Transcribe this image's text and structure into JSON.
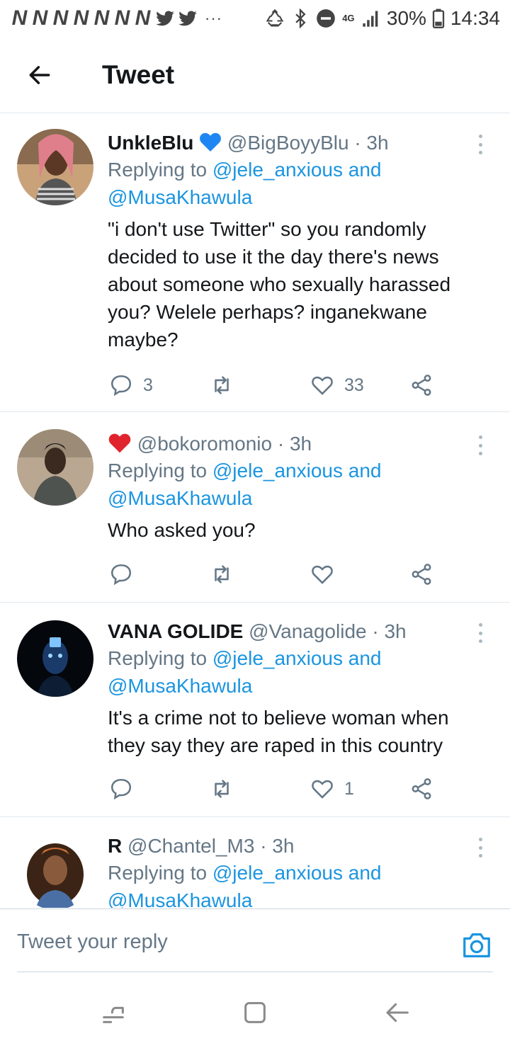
{
  "status_bar": {
    "notification_icons": [
      "N",
      "N",
      "N",
      "N",
      "N",
      "N",
      "N"
    ],
    "overflow": "···",
    "network": "4G",
    "battery": "30%",
    "time": "14:34"
  },
  "header": {
    "title": "Tweet"
  },
  "tweets": [
    {
      "name": "UnkleBlu",
      "name_emoji": "blue-heart",
      "handle": "@BigBoyyBlu",
      "time": "· 3h",
      "replying_prefix": "Replying to ",
      "replying_to_1": "@jele_anxious",
      "replying_and": " and",
      "replying_to_2": "@MusaKhawula",
      "text": "\"i don't use Twitter\" so you randomly decided to use it the day there's news about someone who sexually harassed you? Welele perhaps? inganekwane maybe?",
      "reply_count": "3",
      "retweet_count": "",
      "like_count": "33"
    },
    {
      "name": "",
      "name_emoji": "red-heart",
      "handle": "@bokoromonio",
      "time": "· 3h",
      "replying_prefix": "Replying to ",
      "replying_to_1": "@jele_anxious",
      "replying_and": " and",
      "replying_to_2": "@MusaKhawula",
      "text": "Who asked you?",
      "reply_count": "",
      "retweet_count": "",
      "like_count": ""
    },
    {
      "name": "VANA GOLIDE",
      "handle": "@Vanagolide",
      "time": "· 3h",
      "replying_prefix": "Replying to ",
      "replying_to_1": "@jele_anxious",
      "replying_and": " and",
      "replying_to_2": "@MusaKhawula",
      "text": "It's a crime not to believe woman when they say they are raped in this country",
      "reply_count": "",
      "retweet_count": "",
      "like_count": "1"
    },
    {
      "name": "R",
      "handle": "@Chantel_M3",
      "time": "· 3h",
      "replying_prefix": "Replying to ",
      "replying_to_1": "@jele_anxious",
      "replying_and": " and",
      "replying_to_2": "@MusaKhawula",
      "text": ""
    }
  ],
  "composer": {
    "placeholder": "Tweet your reply"
  },
  "colors": {
    "link": "#1b95e0",
    "text": "#14171a",
    "muted": "#657786",
    "divider": "#e1e8ed"
  },
  "icons": {
    "reply": "reply-icon",
    "retweet": "retweet-icon",
    "like": "heart-icon",
    "share": "share-icon",
    "camera": "camera-icon",
    "back": "back-arrow-icon"
  }
}
